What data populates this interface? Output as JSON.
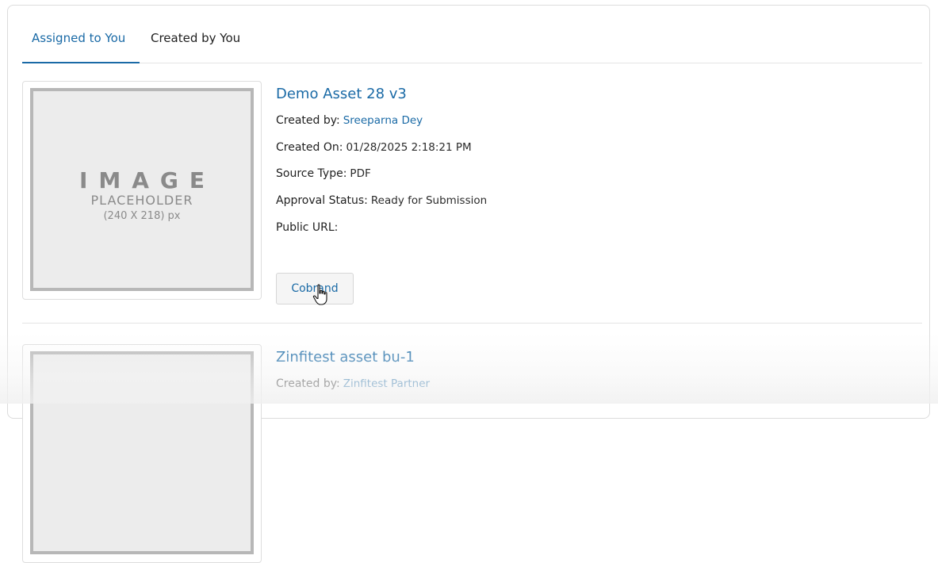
{
  "tabs": [
    {
      "label": "Assigned to You",
      "active": true
    },
    {
      "label": "Created by You",
      "active": false
    }
  ],
  "placeholder": {
    "big": "IMAGE",
    "mid": "PLACEHOLDER",
    "small": "(240 X 218) px"
  },
  "assets": [
    {
      "title": "Demo Asset 28 v3",
      "created_by_label": "Created by:",
      "created_by": "Sreeparna Dey",
      "created_on_label": "Created On:",
      "created_on": "01/28/2025 2:18:21 PM",
      "source_type_label": "Source Type:",
      "source_type": "PDF",
      "approval_status_label": "Approval Status:",
      "approval_status": "Ready for Submission",
      "public_url_label": "Public URL:",
      "public_url": "",
      "cobrand_label": "Cobrand"
    },
    {
      "title": "Zinfitest asset bu-1",
      "created_by_label": "Created by:",
      "created_by": "Zinfitest Partner"
    }
  ],
  "colors": {
    "accent": "#1a6aa6",
    "border": "#dcdcdc",
    "placeholder_bg": "#ececec"
  }
}
